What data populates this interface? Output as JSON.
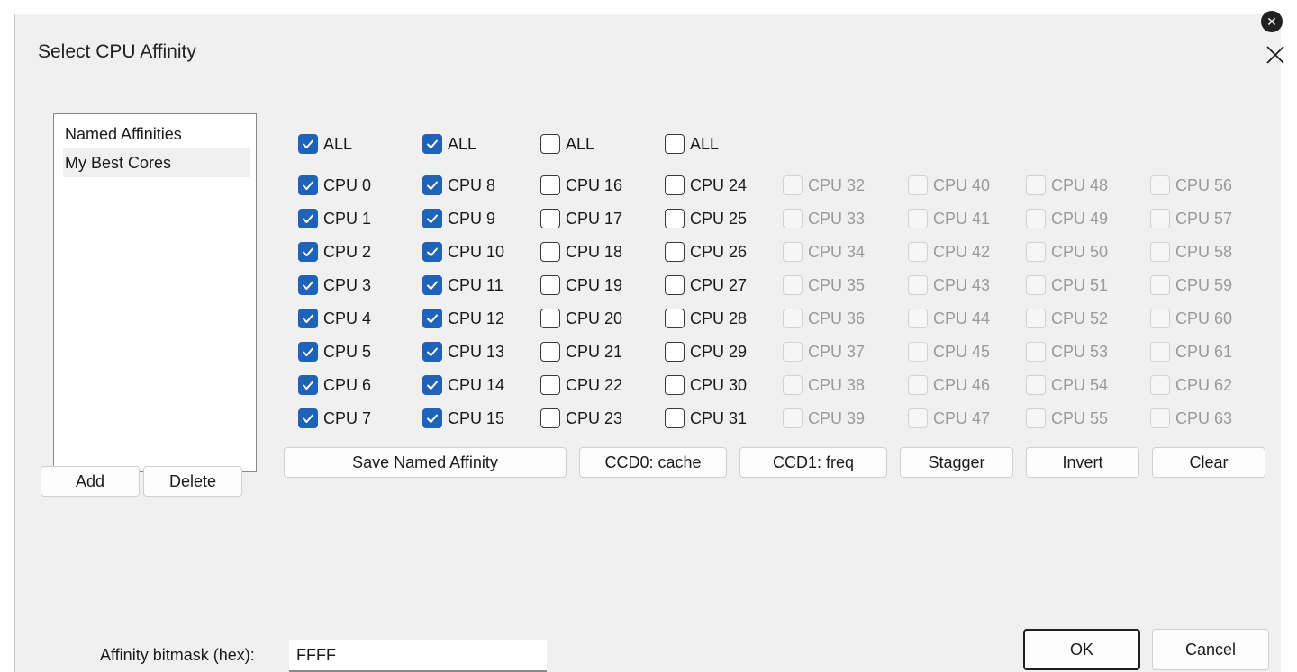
{
  "dialog": {
    "title": "Select CPU Affinity"
  },
  "named_affinities": {
    "items": [
      "Named Affinities",
      "My Best Cores"
    ],
    "selected_index": 1
  },
  "buttons": {
    "add": "Add",
    "delete": "Delete",
    "save_named": "Save Named Affinity",
    "ccd0": "CCD0: cache",
    "ccd1": "CCD1: freq",
    "stagger": "Stagger",
    "invert": "Invert",
    "clear": "Clear",
    "ok": "OK",
    "cancel": "Cancel"
  },
  "groups": [
    {
      "all_label": "ALL",
      "all_checked": true
    },
    {
      "all_label": "ALL",
      "all_checked": true
    },
    {
      "all_label": "ALL",
      "all_checked": false
    },
    {
      "all_label": "ALL",
      "all_checked": false
    }
  ],
  "cpu_label_prefix": "CPU",
  "cpu_count": 64,
  "checked_cpus": [
    0,
    1,
    2,
    3,
    4,
    5,
    6,
    7,
    8,
    9,
    10,
    11,
    12,
    13,
    14,
    15
  ],
  "enabled_cpu_limit": 32,
  "bitmask": {
    "label": "Affinity bitmask (hex):",
    "value": "FFFF"
  },
  "colors": {
    "accent": "#1f63b8",
    "dialog_bg": "#f0f0f0",
    "disabled_text": "#9a9a9a"
  }
}
